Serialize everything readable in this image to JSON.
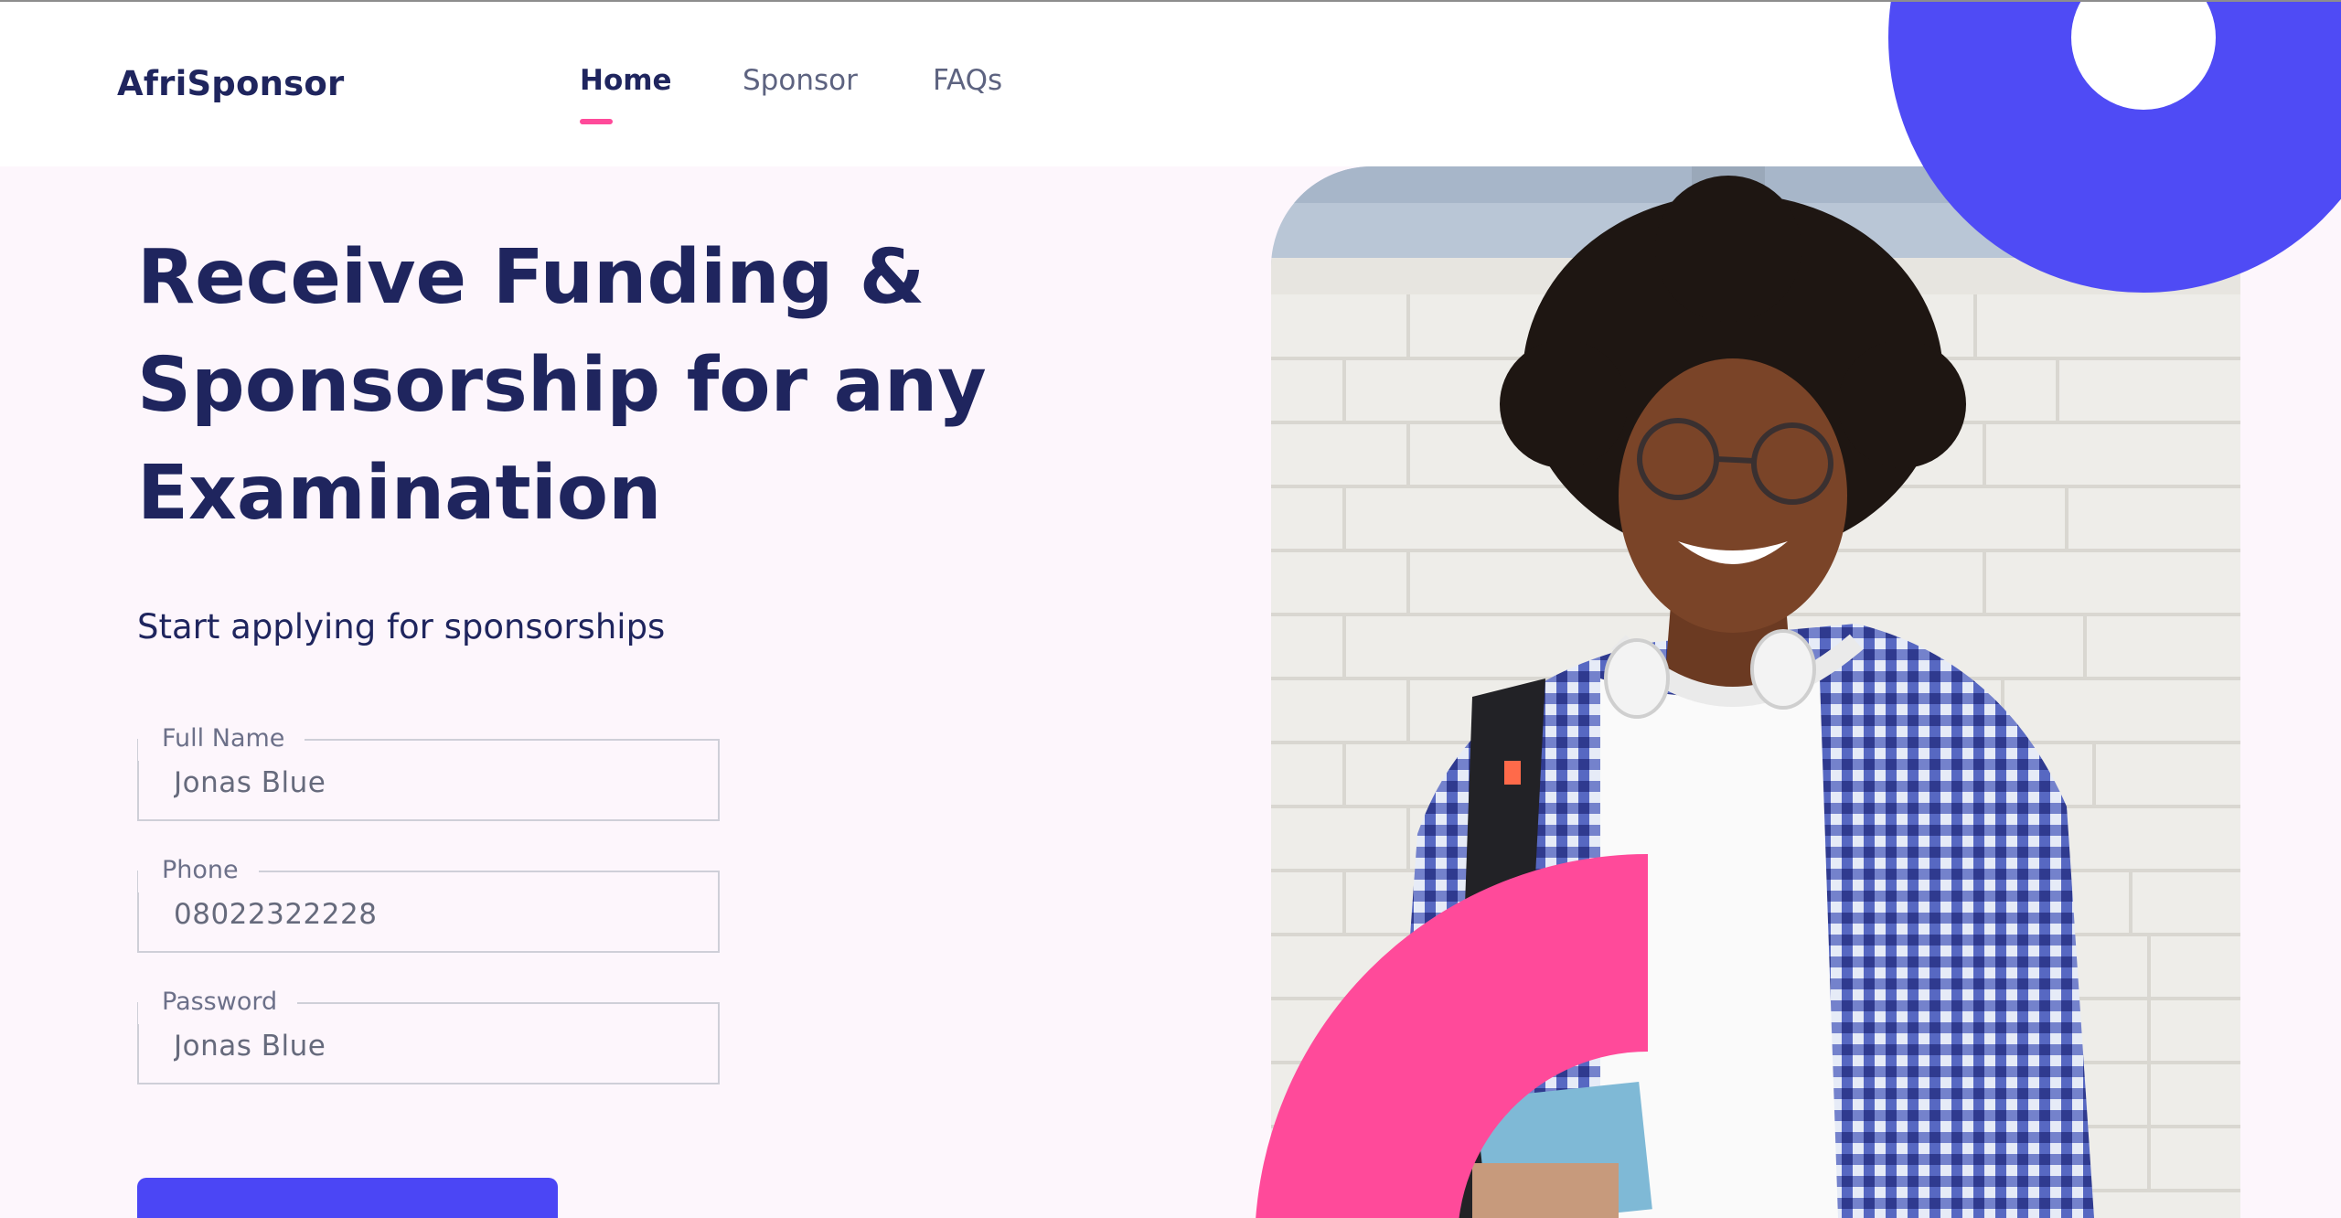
{
  "brand": {
    "name": "AfriSponsor"
  },
  "nav": {
    "items": [
      {
        "label": "Home",
        "active": true
      },
      {
        "label": "Sponsor",
        "active": false
      },
      {
        "label": "FAQs",
        "active": false
      }
    ]
  },
  "hero": {
    "headline": "Receive Funding & Sponsorship for any Examination",
    "subheadline": "Start applying for sponsorships"
  },
  "form": {
    "fields": [
      {
        "label": "Full Name",
        "value": "Jonas Blue"
      },
      {
        "label": "Phone",
        "value": "08022322228"
      },
      {
        "label": "Password",
        "value": "Jonas Blue"
      }
    ]
  },
  "colors": {
    "primary_text": "#1f255e",
    "accent_pink": "#ff4a9a",
    "accent_blue": "#4f4bf5",
    "hero_background": "#fdf6fc"
  }
}
